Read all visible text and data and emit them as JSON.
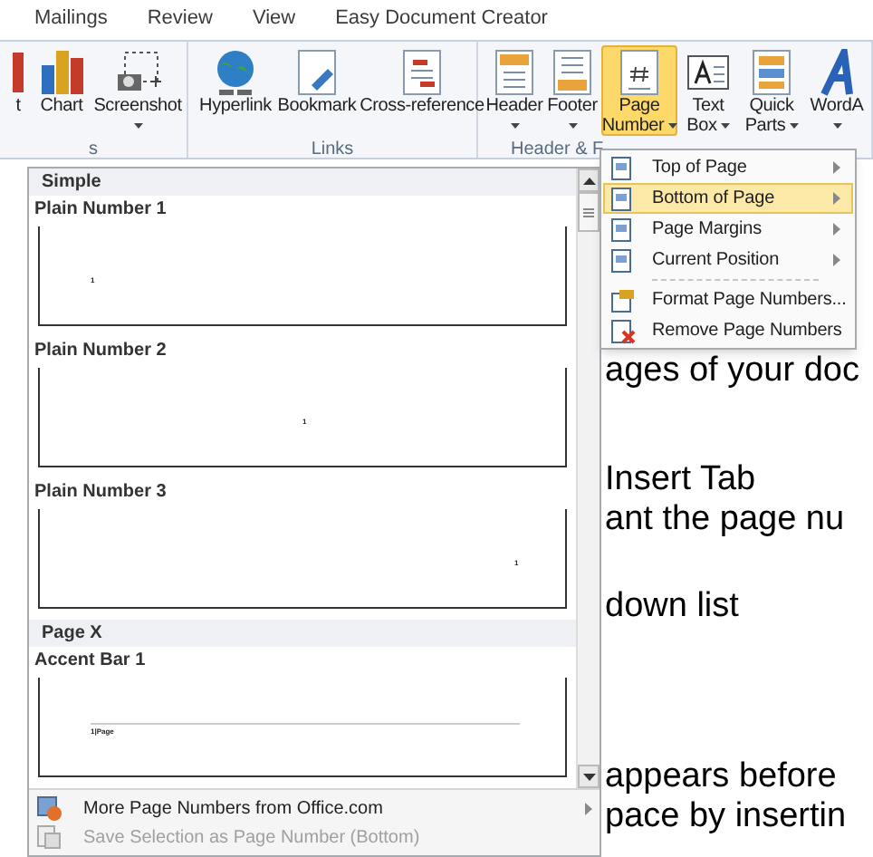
{
  "tabs": [
    {
      "label": "Mailings",
      "selected": false
    },
    {
      "label": "Review",
      "selected": false
    },
    {
      "label": "View",
      "selected": false
    },
    {
      "label": "Easy Document Creator",
      "selected": false
    }
  ],
  "ribbon": {
    "groups": [
      {
        "label": "s",
        "buttons": [
          {
            "kind": "cut",
            "label": "t"
          },
          {
            "kind": "chart",
            "label": "Chart"
          },
          {
            "kind": "screenshot",
            "label": "Screenshot",
            "dropdown": true
          }
        ]
      },
      {
        "label": "Links",
        "buttons": [
          {
            "kind": "globe",
            "label": "Hyperlink"
          },
          {
            "kind": "bookmark",
            "label": "Bookmark"
          },
          {
            "kind": "crossref",
            "label": "Cross-reference"
          }
        ]
      },
      {
        "label": "Header & F",
        "buttons": [
          {
            "kind": "header",
            "label": "Header",
            "dropdown": true
          },
          {
            "kind": "footer",
            "label": "Footer",
            "dropdown": true
          },
          {
            "kind": "pagenum",
            "label": "Page Number",
            "dropdown": true,
            "selected": true
          },
          {
            "kind": "textbox",
            "label": "Text Box",
            "dropdown": true
          },
          {
            "kind": "quickparts",
            "label": "Quick Parts",
            "dropdown": true
          },
          {
            "kind": "wordart",
            "label": "WordA",
            "dropdown": true
          }
        ]
      }
    ]
  },
  "menu": {
    "items": [
      {
        "label": "Top of Page",
        "submenu": true,
        "selected": false,
        "kind": "page"
      },
      {
        "label": "Bottom of Page",
        "submenu": true,
        "selected": true,
        "kind": "page"
      },
      {
        "label": "Page Margins",
        "submenu": true,
        "selected": false,
        "kind": "page"
      },
      {
        "label": "Current Position",
        "submenu": true,
        "selected": false,
        "kind": "page"
      },
      {
        "label": "Format Page Numbers...",
        "submenu": false,
        "selected": false,
        "kind": "format"
      },
      {
        "label": "Remove Page Numbers",
        "submenu": false,
        "selected": false,
        "kind": "remove"
      }
    ]
  },
  "gallery": {
    "sections": [
      {
        "heading": "Simple",
        "items": [
          {
            "label": "Plain Number 1",
            "kind": "left",
            "preview": "1"
          },
          {
            "label": "Plain Number 2",
            "kind": "center",
            "preview": "1"
          },
          {
            "label": "Plain Number 3",
            "kind": "right",
            "preview": "1"
          }
        ]
      },
      {
        "heading": "Page X",
        "items": [
          {
            "label": "Accent Bar 1",
            "kind": "accent",
            "preview": "1|Page"
          }
        ]
      }
    ],
    "footer_items": [
      {
        "label": "More Page Numbers from Office.com",
        "submenu": true,
        "disabled": false
      },
      {
        "label": "Save Selection as Page Number (Bottom)",
        "submenu": false,
        "disabled": true
      }
    ]
  },
  "document": {
    "lines": [
      "ages of your doc",
      "Insert Tab",
      "ant the page nu",
      "down list",
      "appears before",
      "pace by insertin"
    ]
  }
}
